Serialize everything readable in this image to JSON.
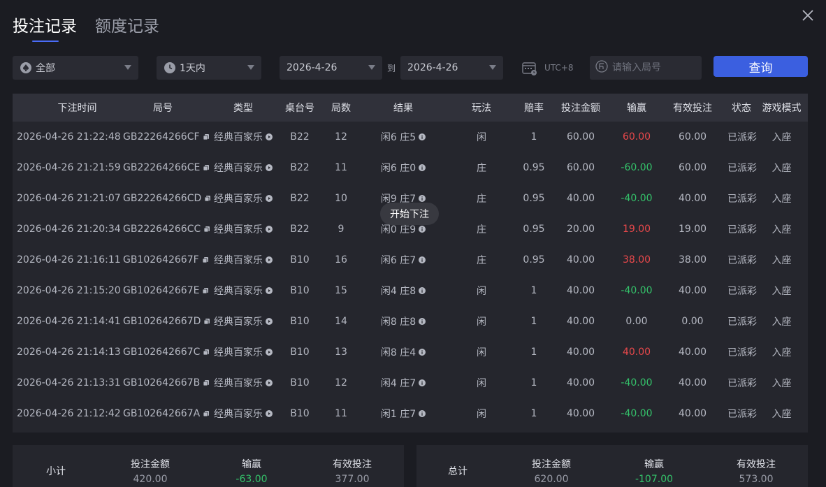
{
  "tabs": {
    "bet_records": "投注记录",
    "quota_records": "额度记录"
  },
  "filters": {
    "game": "全部",
    "time_range": "1天内",
    "date_from": "2026-4-26",
    "to_label": "到",
    "date_to": "2026-4-26",
    "timezone": "UTC+8",
    "round_placeholder": "请输入局号",
    "query_button": "查询"
  },
  "table": {
    "headers": [
      "下注时间",
      "局号",
      "类型",
      "桌台号",
      "局数",
      "结果",
      "玩法",
      "赔率",
      "投注金额",
      "输赢",
      "有效投注",
      "状态",
      "游戏模式"
    ],
    "rows": [
      {
        "time": "2026-04-26 21:22:48",
        "round_id": "GB22264266CF",
        "type": "经典百家乐",
        "table": "B22",
        "round_no": "12",
        "result": "闲6 庄5",
        "play": "闲",
        "odds": "1",
        "amount": "60.00",
        "winloss": "60.00",
        "wl": "win",
        "valid": "60.00",
        "status": "已派彩",
        "mode": "入座"
      },
      {
        "time": "2026-04-26 21:21:59",
        "round_id": "GB22264266CE",
        "type": "经典百家乐",
        "table": "B22",
        "round_no": "11",
        "result": "闲6 庄0",
        "play": "庄",
        "odds": "0.95",
        "amount": "60.00",
        "winloss": "-60.00",
        "wl": "loss",
        "valid": "60.00",
        "status": "已派彩",
        "mode": "入座"
      },
      {
        "time": "2026-04-26 21:21:07",
        "round_id": "GB22264266CD",
        "type": "经典百家乐",
        "table": "B22",
        "round_no": "10",
        "result": "闲9 庄7",
        "play": "庄",
        "odds": "0.95",
        "amount": "40.00",
        "winloss": "-40.00",
        "wl": "loss",
        "valid": "40.00",
        "status": "已派彩",
        "mode": "入座"
      },
      {
        "time": "2026-04-26 21:20:34",
        "round_id": "GB22264266CC",
        "type": "经典百家乐",
        "table": "B22",
        "round_no": "9",
        "result": "闲0 庄9",
        "play": "庄",
        "odds": "0.95",
        "amount": "20.00",
        "winloss": "19.00",
        "wl": "win",
        "valid": "19.00",
        "status": "已派彩",
        "mode": "入座"
      },
      {
        "time": "2026-04-26 21:16:11",
        "round_id": "GB102642667F",
        "type": "经典百家乐",
        "table": "B10",
        "round_no": "16",
        "result": "闲6 庄7",
        "play": "庄",
        "odds": "0.95",
        "amount": "40.00",
        "winloss": "38.00",
        "wl": "win",
        "valid": "38.00",
        "status": "已派彩",
        "mode": "入座"
      },
      {
        "time": "2026-04-26 21:15:20",
        "round_id": "GB102642667E",
        "type": "经典百家乐",
        "table": "B10",
        "round_no": "15",
        "result": "闲4 庄8",
        "play": "闲",
        "odds": "1",
        "amount": "40.00",
        "winloss": "-40.00",
        "wl": "loss",
        "valid": "40.00",
        "status": "已派彩",
        "mode": "入座"
      },
      {
        "time": "2026-04-26 21:14:41",
        "round_id": "GB102642667D",
        "type": "经典百家乐",
        "table": "B10",
        "round_no": "14",
        "result": "闲8 庄8",
        "play": "闲",
        "odds": "1",
        "amount": "40.00",
        "winloss": "0.00",
        "wl": "none",
        "valid": "0.00",
        "status": "已派彩",
        "mode": "入座"
      },
      {
        "time": "2026-04-26 21:14:13",
        "round_id": "GB102642667C",
        "type": "经典百家乐",
        "table": "B10",
        "round_no": "13",
        "result": "闲8 庄4",
        "play": "闲",
        "odds": "1",
        "amount": "40.00",
        "winloss": "40.00",
        "wl": "win",
        "valid": "40.00",
        "status": "已派彩",
        "mode": "入座"
      },
      {
        "time": "2026-04-26 21:13:31",
        "round_id": "GB102642667B",
        "type": "经典百家乐",
        "table": "B10",
        "round_no": "12",
        "result": "闲4 庄7",
        "play": "闲",
        "odds": "1",
        "amount": "40.00",
        "winloss": "-40.00",
        "wl": "loss",
        "valid": "40.00",
        "status": "已派彩",
        "mode": "入座"
      },
      {
        "time": "2026-04-26 21:12:42",
        "round_id": "GB102642667A",
        "type": "经典百家乐",
        "table": "B10",
        "round_no": "11",
        "result": "闲1 庄7",
        "play": "闲",
        "odds": "1",
        "amount": "40.00",
        "winloss": "-40.00",
        "wl": "loss",
        "valid": "40.00",
        "status": "已派彩",
        "mode": "入座"
      }
    ]
  },
  "toast": "开始下注",
  "subtotal": {
    "label": "小计",
    "amount_label": "投注金额",
    "amount": "420.00",
    "winloss_label": "输赢",
    "winloss": "-63.00",
    "valid_label": "有效投注",
    "valid": "377.00"
  },
  "total": {
    "label": "总计",
    "amount_label": "投注金额",
    "amount": "620.00",
    "winloss_label": "输赢",
    "winloss": "-107.00",
    "valid_label": "有效投注",
    "valid": "573.00"
  },
  "colors": {
    "accent": "#3b5fe0",
    "win": "#e8484b",
    "loss": "#34c26a"
  }
}
